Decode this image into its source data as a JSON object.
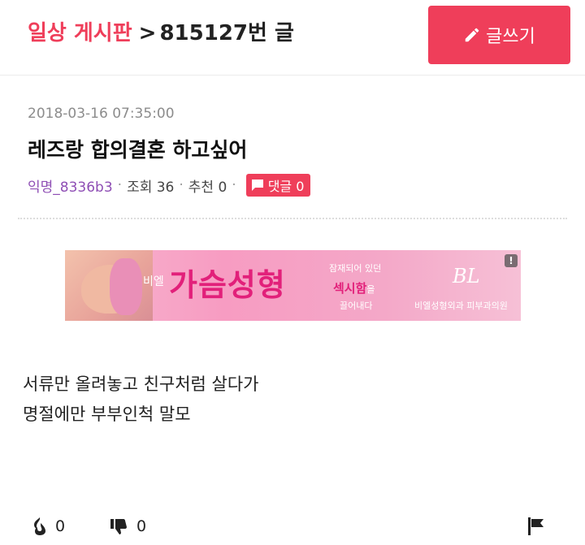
{
  "header": {
    "board_name": "일상 게시판",
    "separator": ">",
    "post_number": "815127번 글",
    "write_button_label": "글쓰기"
  },
  "post": {
    "date": "2018-03-16 07:35:00",
    "title": "레즈랑 합의결혼 하고싶어",
    "author": "익명_8336b3",
    "views_label": "조회 36",
    "likes_label": "추천 0",
    "comment_label": "댓글 0",
    "body_lines": [
      "서류만 올려놓고 친구처럼 살다가",
      "명절에만 부부인척 말모"
    ]
  },
  "ad": {
    "sub_label": "비엘",
    "main_text": "가슴성형",
    "line1": "잠재되어 있던",
    "line2_highlight": "섹시함",
    "line2_rest": "을",
    "line3": "끌어내다",
    "logo": "BL",
    "clinic_name": "비엘성형외과 피부과의원",
    "info_icon": "!"
  },
  "actions": {
    "like_count": "0",
    "dislike_count": "0"
  },
  "colors": {
    "accent": "#ef3e5a",
    "author": "#8f4fb5",
    "date": "#8c8c8c"
  },
  "icons": {
    "write": "pencil-icon",
    "comment": "speech-bubble-icon",
    "like": "flame-icon",
    "dislike": "thumbs-down-icon",
    "report": "flag-icon"
  }
}
